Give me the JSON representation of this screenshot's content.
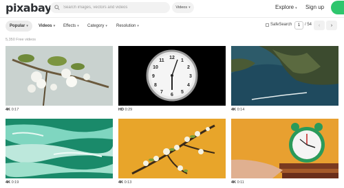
{
  "header": {
    "logo": "pixabay",
    "search_placeholder": "Search images, vectors and videos",
    "media_type": "Videos",
    "explore": "Explore",
    "signup": "Sign up"
  },
  "filters": {
    "popular": "Popular",
    "videos": "Videos",
    "effects": "Effects",
    "category": "Category",
    "resolution": "Resolution",
    "safesearch": "SafeSearch",
    "page": "1",
    "total_pages": "/ 54",
    "prev": "‹",
    "next": "›"
  },
  "result_count": "5,350 Free videos",
  "videos": [
    {
      "quality": "4K",
      "duration": "0:17"
    },
    {
      "quality": "HD",
      "duration": "0:29"
    },
    {
      "quality": "4K",
      "duration": "0:14"
    },
    {
      "quality": "4K",
      "duration": "0:19"
    },
    {
      "quality": "4K",
      "duration": "0:13"
    },
    {
      "quality": "4K",
      "duration": "0:11"
    }
  ],
  "colors": {
    "accent": "#2ec66d"
  }
}
